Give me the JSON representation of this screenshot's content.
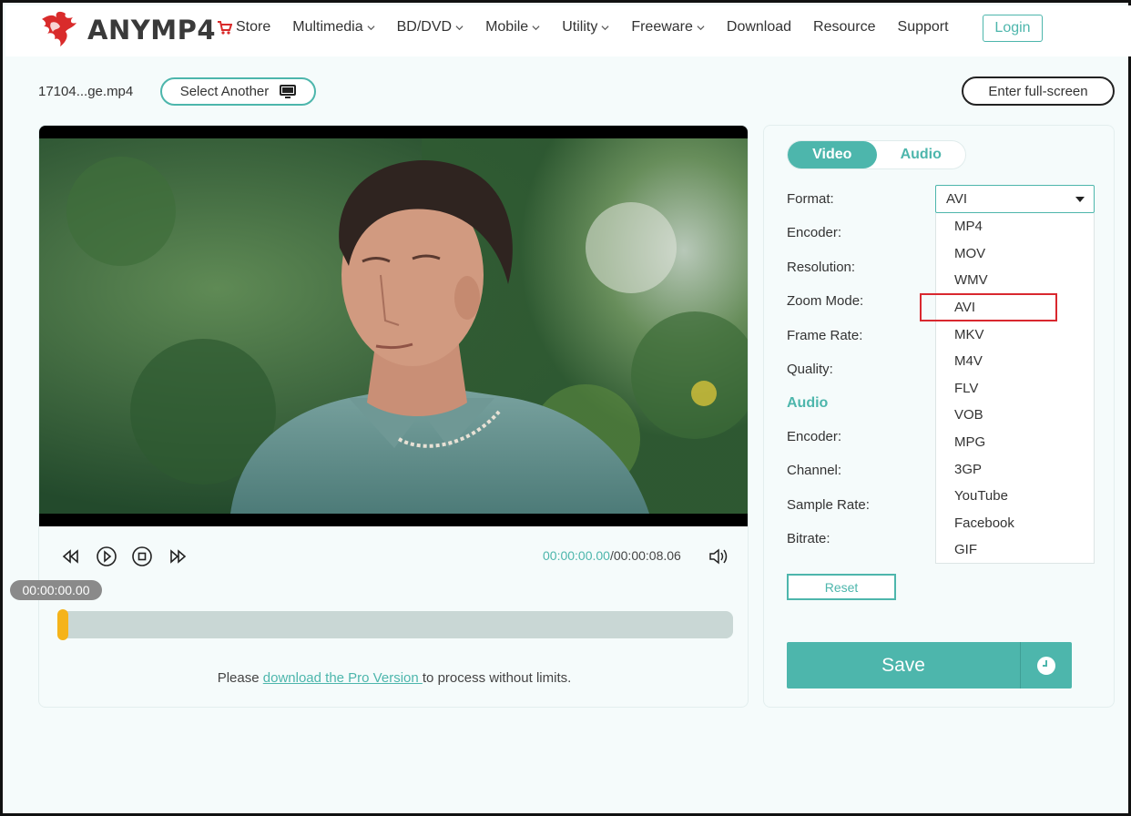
{
  "brand": {
    "name": "ANYMP4"
  },
  "nav": {
    "items": [
      {
        "label": "Store",
        "has_dropdown": false,
        "icon": "cart-icon"
      },
      {
        "label": "Multimedia",
        "has_dropdown": true
      },
      {
        "label": "BD/DVD",
        "has_dropdown": true
      },
      {
        "label": "Mobile",
        "has_dropdown": true
      },
      {
        "label": "Utility",
        "has_dropdown": true
      },
      {
        "label": "Freeware",
        "has_dropdown": true
      },
      {
        "label": "Download",
        "has_dropdown": false
      },
      {
        "label": "Resource",
        "has_dropdown": false
      },
      {
        "label": "Support",
        "has_dropdown": false
      }
    ],
    "login_label": "Login"
  },
  "file": {
    "name": "17104...ge.mp4",
    "select_another_label": "Select Another",
    "fullscreen_label": "Enter full-screen"
  },
  "player": {
    "current_time": "00:00:00.00",
    "separator": "/",
    "total_time": "00:00:08.06",
    "badge_time": "00:00:00.00",
    "progress": 0
  },
  "note": {
    "before": "Please ",
    "link": "download the Pro Version ",
    "after": "to process without limits."
  },
  "settings": {
    "tabs": [
      {
        "label": "Video",
        "active": true
      },
      {
        "label": "Audio",
        "active": false
      }
    ],
    "video_fields": [
      "Format:",
      "Encoder:",
      "Resolution:",
      "Zoom Mode:",
      "Frame Rate:",
      "Quality:"
    ],
    "audio_section_title": "Audio",
    "audio_fields": [
      "Encoder:",
      "Channel:",
      "Sample Rate:",
      "Bitrate:"
    ],
    "format_selected": "AVI",
    "format_options": [
      "MP4",
      "MOV",
      "WMV",
      "AVI",
      "MKV",
      "M4V",
      "FLV",
      "VOB",
      "MPG",
      "3GP",
      "YouTube",
      "Facebook",
      "GIF"
    ],
    "highlighted_option": "AVI",
    "reset_label": "Reset",
    "save_label": "Save"
  },
  "colors": {
    "accent": "#4db6ac",
    "handle": "#f5b31a",
    "highlight": "#d9282f"
  }
}
